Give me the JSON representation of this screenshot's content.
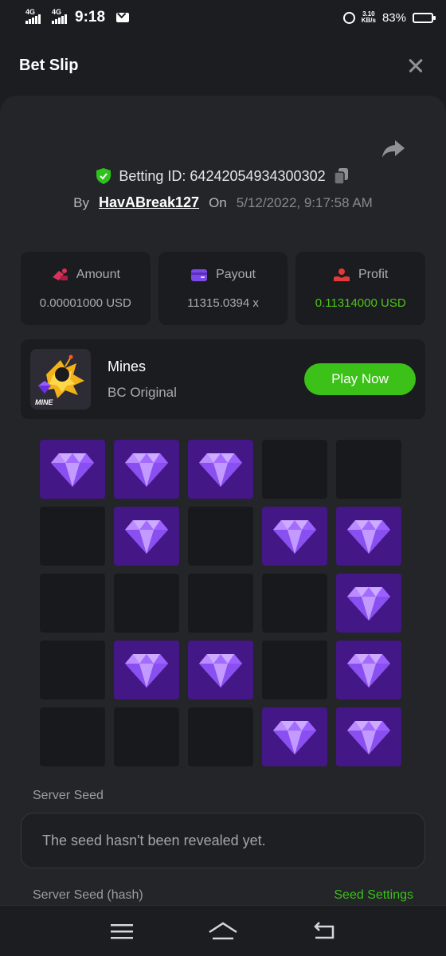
{
  "status_bar": {
    "network1": "4G",
    "network2": "4G",
    "time": "9:18",
    "net_speed_top": "3.10",
    "net_speed_bottom": "KB/s",
    "battery": "83%",
    "battery_level": 0.83
  },
  "header": {
    "title": "Bet Slip"
  },
  "bet": {
    "betting_id_label": "Betting ID: 64242054934300302",
    "by_label": "By",
    "username": "HavABreak127",
    "on_label": "On",
    "datetime": "5/12/2022, 9:17:58 AM"
  },
  "stats": [
    {
      "label": "Amount",
      "value": "0.00001000 USD",
      "icon": "amount-icon",
      "color": "#d9325a"
    },
    {
      "label": "Payout",
      "value": "11315.0394 x",
      "icon": "wallet-icon",
      "color": "#7b4ae6"
    },
    {
      "label": "Profit",
      "value": "0.11314000 USD",
      "icon": "profit-icon",
      "color": "#e23a3a",
      "value_color": "#4fc21a"
    }
  ],
  "game": {
    "name": "Mines",
    "provider": "BC Original",
    "thumb_text": "MINE",
    "play_label": "Play Now"
  },
  "mines_grid": [
    [
      1,
      1,
      1,
      0,
      0
    ],
    [
      0,
      1,
      0,
      1,
      1
    ],
    [
      0,
      0,
      0,
      0,
      1
    ],
    [
      0,
      1,
      1,
      0,
      1
    ],
    [
      0,
      0,
      0,
      1,
      1
    ]
  ],
  "seed": {
    "server_seed_label": "Server Seed",
    "server_seed_value": "The seed hasn't been revealed yet.",
    "server_seed_hash_label": "Server Seed (hash)",
    "seed_settings_label": "Seed Settings"
  },
  "colors": {
    "accent_green": "#3bc117",
    "gem_tile": "#431786",
    "empty_tile": "#18191c"
  }
}
